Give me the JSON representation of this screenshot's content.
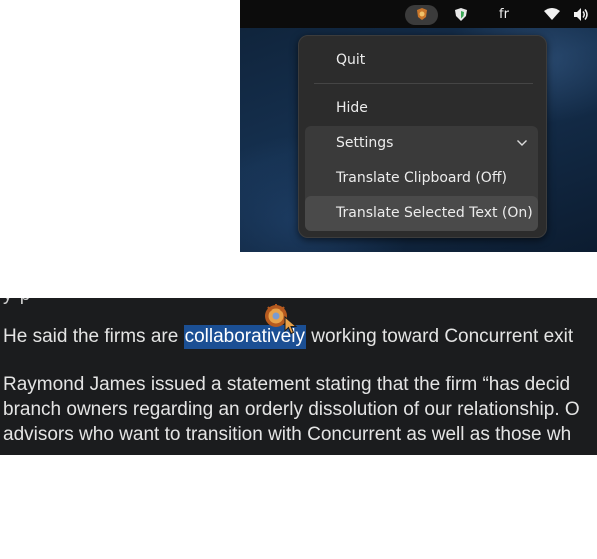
{
  "panel": {
    "icons": [
      "translator-tray-icon",
      "shield-icon",
      "wifi-icon",
      "volume-icon"
    ],
    "language": "fr"
  },
  "menu": {
    "quit": "Quit",
    "hide": "Hide",
    "settings": "Settings",
    "translate_clipboard": "Translate Clipboard (Off)",
    "translate_selected": "Translate Selected Text (On)"
  },
  "article": {
    "cut_line": "    y                                          p",
    "para1_before": "He said the firms are ",
    "para1_selected": "collaboratively",
    "para1_after": " working toward Concurrent exit",
    "para2_line1": "Raymond James issued a statement stating that the firm “has decid",
    "para2_line2": "branch owners regarding an orderly dissolution of our relationship. O",
    "para2_line3": "advisors who want to transition with Concurrent as well as those wh"
  },
  "colors": {
    "selection": "#1b4f94",
    "article_background": "#1b1c1e",
    "menu_background": "#2c2c2c",
    "panel_background": "#0c0c0c"
  }
}
